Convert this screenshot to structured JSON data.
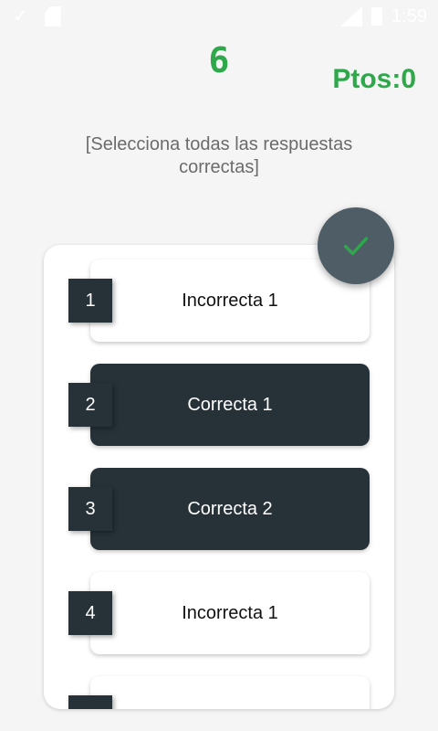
{
  "status_bar": {
    "time": "1:59",
    "icons": [
      "check-icon",
      "sd-card-icon",
      "signal-icon",
      "battery-icon"
    ]
  },
  "quiz": {
    "counter": "6",
    "score": "Ptos:0",
    "instruction": "[Selecciona todas las respuestas correctas]",
    "options": [
      {
        "number": "1",
        "label": "Incorrecta 1",
        "selected": false
      },
      {
        "number": "2",
        "label": "Correcta 1",
        "selected": true
      },
      {
        "number": "3",
        "label": "Correcta 2",
        "selected": true
      },
      {
        "number": "4",
        "label": "Incorrecta 1",
        "selected": false
      },
      {
        "number": "",
        "label": "",
        "selected": false
      }
    ]
  },
  "fab": {
    "icon": "check-icon"
  },
  "colors": {
    "accent": "#2ea84a",
    "dark": "#263238",
    "fab": "#4e5d66",
    "background": "#f5f5f5"
  }
}
